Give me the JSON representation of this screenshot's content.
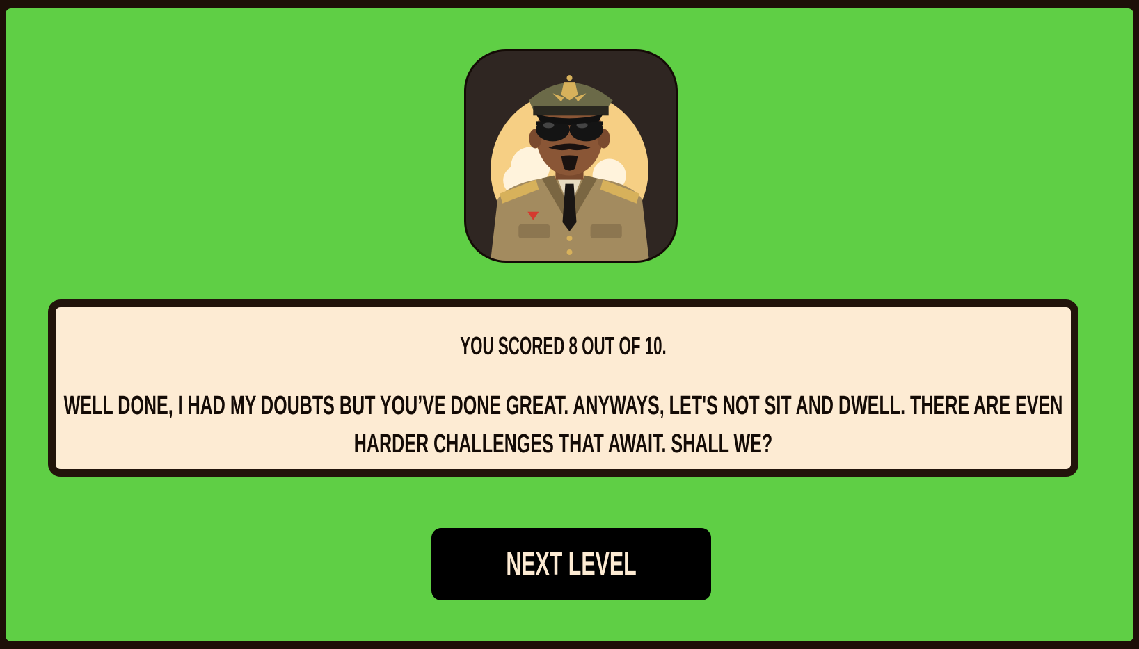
{
  "dialog": {
    "avatar_icon": "army-officer-avatar-icon",
    "score_text": "You scored 8 out of 10.",
    "message_text": "Well done, I had my doubts but you’ve done great. Anyways, let's not sit and dwell. There are even harder challenges that await. Shall we?"
  },
  "actions": {
    "next_label": "Next Level"
  },
  "colors": {
    "background": "#5fcf45",
    "frame_border": "#1d0f08",
    "panel_fill": "#fdebd3",
    "panel_border": "#22140b",
    "button_fill": "#000000",
    "button_text": "#fdebd3"
  }
}
